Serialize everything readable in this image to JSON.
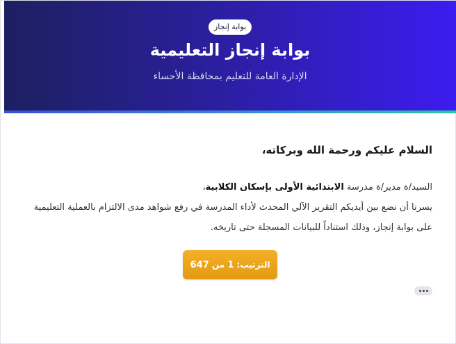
{
  "header": {
    "badge": "بوابة إنجاز",
    "title": "بوابة إنجاز التعليمية",
    "subtitle": "الإدارة العامة للتعليم بمحافظة الأحساء"
  },
  "message": {
    "greeting": "السلام عليكم ورحمة الله وبركاته،",
    "salutation_prefix": "السيد/ة مدير/ة مدرسة",
    "school_name": "الابتدائية الأولى بإسكان الكلابية",
    "salutation_suffix": "،",
    "paragraph": "يسرنا أن نضع بين أيديكم التقرير الآلي المحدث لأداء المدرسة في رفع شواهد مدى الالتزام بالعملية التعليمية على بوابة إنجاز، وذلك استناداً للبيانات المسجلة حتى تاريخه."
  },
  "rank": {
    "label": "الترتيب:",
    "position": "1",
    "of": "من",
    "total": "647"
  },
  "more": {
    "icon": "more-horizontal-icon"
  }
}
